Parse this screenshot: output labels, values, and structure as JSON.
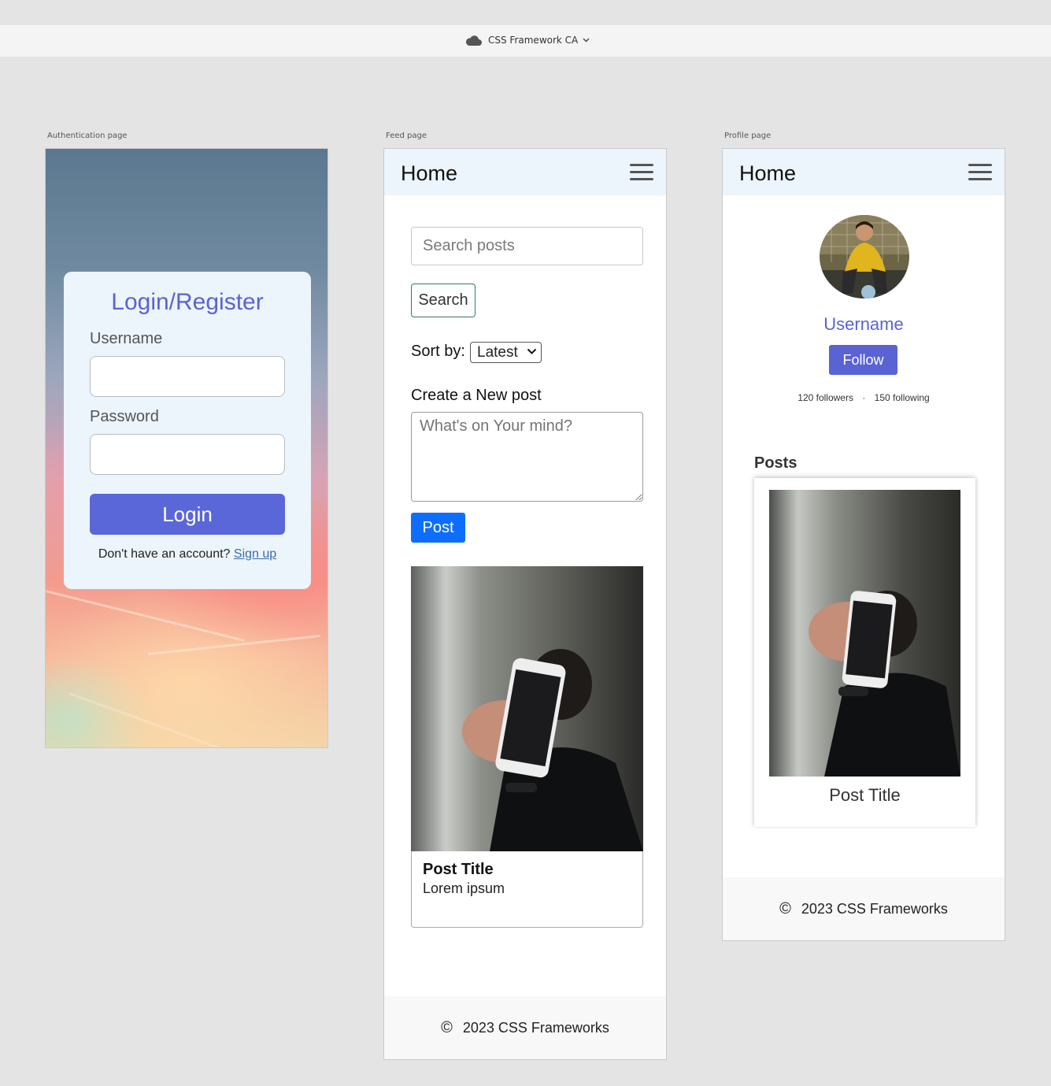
{
  "app": {
    "document_title": "CSS Framework CA"
  },
  "artboards": {
    "auth_label": "Authentication page",
    "feed_label": "Feed page",
    "profile_label": "Profile page"
  },
  "auth": {
    "heading": "Login/Register",
    "username_label": "Username",
    "password_label": "Password",
    "login_button": "Login",
    "signup_prompt": "Don't have an account?",
    "signup_link": "Sign up"
  },
  "feed": {
    "nav_title": "Home",
    "search_placeholder": "Search posts",
    "search_button": "Search",
    "sort_label": "Sort by:",
    "sort_selected": "Latest",
    "new_post_label": "Create a New post",
    "new_post_placeholder": "What's on Your mind?",
    "post_button": "Post",
    "post": {
      "title": "Post Title",
      "body": "Lorem ipsum"
    },
    "footer": "2023 CSS Frameworks"
  },
  "profile": {
    "nav_title": "Home",
    "username": "Username",
    "follow_button": "Follow",
    "followers": "120 followers",
    "following": "150 following",
    "posts_heading": "Posts",
    "post_title": "Post Title",
    "footer": "2023 CSS Frameworks"
  },
  "colors": {
    "accent": "#5a63d3",
    "primary_blue": "#0d6efd",
    "nav_background": "#ecf4fc",
    "canvas": "#e4e4e4"
  },
  "icons": {
    "document": "cloud-icon",
    "menu": "hamburger-menu-icon",
    "dropdown": "chevron-down-icon",
    "copyright": "copyright-icon"
  }
}
